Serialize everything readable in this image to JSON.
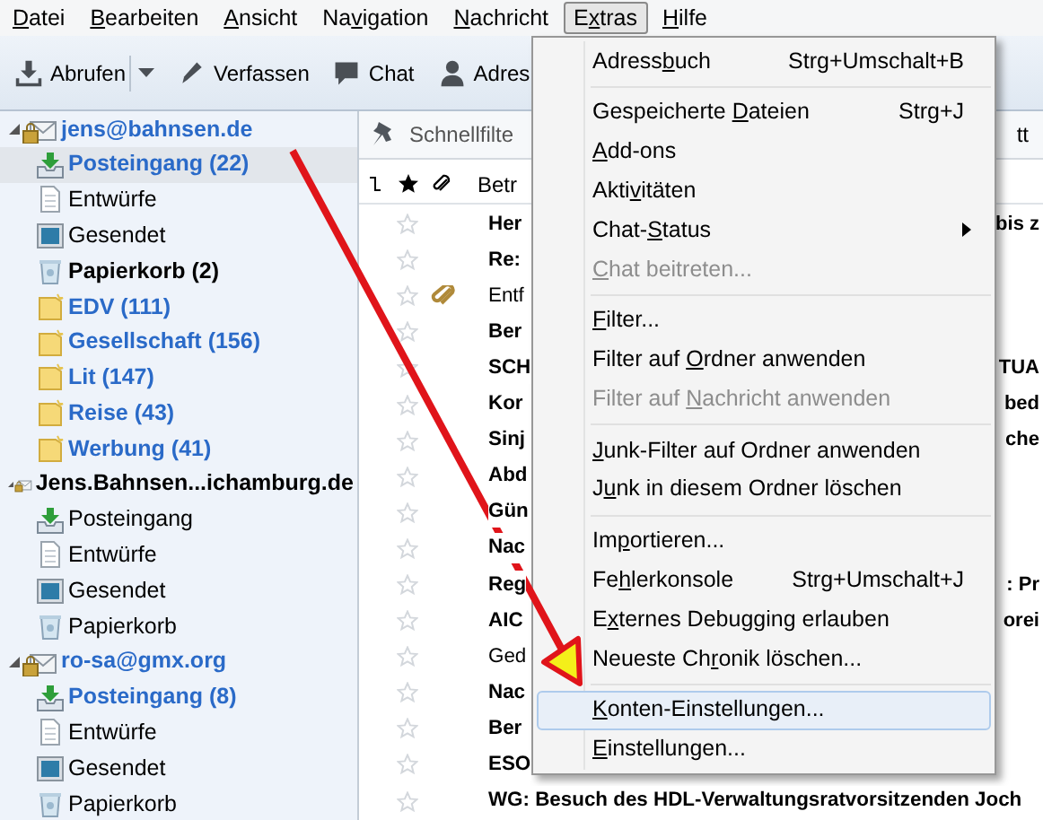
{
  "menubar": [
    {
      "key": "D",
      "after": "atei",
      "selected": false
    },
    {
      "key": "B",
      "after": "earbeiten",
      "selected": false
    },
    {
      "key": "A",
      "after": "nsicht",
      "selected": false
    },
    {
      "before": "Na",
      "key": "v",
      "after": "igation",
      "selected": false
    },
    {
      "key": "N",
      "after": "achricht",
      "selected": false
    },
    {
      "before": "E",
      "key": "x",
      "after": "tras",
      "selected": true
    },
    {
      "key": "H",
      "after": "ilfe",
      "selected": false
    }
  ],
  "toolbar": [
    {
      "kind": "get",
      "label": "Abrufen",
      "dropdown": true
    },
    {
      "kind": "compose",
      "label": "Verfassen",
      "dropdown": false
    },
    {
      "kind": "chat",
      "label": "Chat",
      "dropdown": false
    },
    {
      "kind": "contacts",
      "label": "Adres",
      "dropdown": false
    }
  ],
  "folders": [
    {
      "kind": "account",
      "label": "jens@bahnsen.de",
      "new": true,
      "unread": true,
      "expanded": true,
      "selected": false,
      "children": [
        {
          "kind": "inbox",
          "label": "Posteingang (22)",
          "new": true,
          "unread": true,
          "selected": true
        },
        {
          "kind": "drafts",
          "label": "Entwürfe",
          "new": false,
          "unread": false,
          "selected": false
        },
        {
          "kind": "sent",
          "label": "Gesendet",
          "new": false,
          "unread": false,
          "selected": false
        },
        {
          "kind": "trash",
          "label": "Papierkorb (2)",
          "new": false,
          "unread": true,
          "selected": false
        },
        {
          "kind": "folder",
          "label": "EDV (111)",
          "new": true,
          "unread": true,
          "selected": false
        },
        {
          "kind": "folder",
          "label": "Gesellschaft (156)",
          "new": true,
          "unread": true,
          "selected": false
        },
        {
          "kind": "folder",
          "label": "Lit (147)",
          "new": true,
          "unread": true,
          "selected": false
        },
        {
          "kind": "folder",
          "label": "Reise (43)",
          "new": true,
          "unread": true,
          "selected": false
        },
        {
          "kind": "folder",
          "label": "Werbung (41)",
          "new": true,
          "unread": true,
          "selected": false
        }
      ]
    },
    {
      "kind": "account",
      "label": "Jens.Bahnsen...ichamburg.de",
      "new": false,
      "unread": true,
      "expanded": true,
      "selected": false,
      "children": [
        {
          "kind": "inbox",
          "label": "Posteingang",
          "new": false,
          "unread": false,
          "selected": false
        },
        {
          "kind": "drafts",
          "label": "Entwürfe",
          "new": false,
          "unread": false,
          "selected": false
        },
        {
          "kind": "sent",
          "label": "Gesendet",
          "new": false,
          "unread": false,
          "selected": false
        },
        {
          "kind": "trash",
          "label": "Papierkorb",
          "new": false,
          "unread": false,
          "selected": false
        }
      ]
    },
    {
      "kind": "account",
      "label": "ro-sa@gmx.org",
      "new": true,
      "unread": true,
      "expanded": true,
      "selected": false,
      "children": [
        {
          "kind": "inbox",
          "label": "Posteingang (8)",
          "new": true,
          "unread": true,
          "selected": false
        },
        {
          "kind": "drafts",
          "label": "Entwürfe",
          "new": false,
          "unread": false,
          "selected": false
        },
        {
          "kind": "sent",
          "label": "Gesendet",
          "new": false,
          "unread": false,
          "selected": false
        },
        {
          "kind": "trash",
          "label": "Papierkorb",
          "new": false,
          "unread": false,
          "selected": false
        }
      ]
    }
  ],
  "quick_filter": {
    "label": "Schnellfilte",
    "tail": "tt"
  },
  "columns": {
    "subject": "Betr"
  },
  "messages": [
    {
      "subject": "Her",
      "tail": "bis z",
      "unread": true,
      "attachment": false
    },
    {
      "subject": "Re:",
      "unread": true,
      "attachment": false
    },
    {
      "subject": "Entf",
      "unread": false,
      "attachment": true
    },
    {
      "subject": "Ber",
      "unread": true,
      "attachment": false
    },
    {
      "subject": "SCH",
      "tail": "TUA",
      "unread": true,
      "attachment": false
    },
    {
      "subject": "Kor",
      "tail": "bed",
      "unread": true,
      "attachment": false
    },
    {
      "subject": "Sinj",
      "tail": "che",
      "unread": true,
      "attachment": false
    },
    {
      "subject": "Abd",
      "unread": true,
      "attachment": false
    },
    {
      "subject": "Gün",
      "unread": true,
      "attachment": false
    },
    {
      "subject": "Nac",
      "unread": true,
      "attachment": false
    },
    {
      "subject": "Reg",
      "tail": ": Pr",
      "unread": true,
      "attachment": false
    },
    {
      "subject": "AIC",
      "tail": "orei",
      "unread": true,
      "attachment": false
    },
    {
      "subject": "Ged",
      "unread": false,
      "attachment": false
    },
    {
      "subject": "Nac",
      "unread": true,
      "attachment": false
    },
    {
      "subject": "Ber",
      "unread": true,
      "attachment": false
    },
    {
      "subject": "ESO",
      "unread": true,
      "attachment": false
    },
    {
      "subject": "WG: Besuch des HDL-Verwaltungsratvorsitzenden Joch",
      "unread": true,
      "attachment": false
    }
  ],
  "extras_menu": [
    {
      "kind": "item",
      "before": "Adress",
      "key": "b",
      "after": "uch",
      "shortcut": "Strg+Umschalt+B",
      "disabled": false,
      "submenu": false,
      "selected": false
    },
    {
      "kind": "separator"
    },
    {
      "kind": "item",
      "before": "Gespeicherte ",
      "key": "D",
      "after": "ateien",
      "shortcut": "Strg+J",
      "disabled": false,
      "submenu": false,
      "selected": false
    },
    {
      "kind": "item",
      "key": "A",
      "after": "dd-ons",
      "disabled": false,
      "submenu": false,
      "selected": false
    },
    {
      "kind": "item",
      "before": "Akti",
      "key": "v",
      "after": "itäten",
      "disabled": false,
      "submenu": false,
      "selected": false
    },
    {
      "kind": "item",
      "before": "Chat-",
      "key": "S",
      "after": "tatus",
      "disabled": false,
      "submenu": true,
      "selected": false
    },
    {
      "kind": "item",
      "key": "C",
      "after": "hat beitreten...",
      "disabled": true,
      "submenu": false,
      "selected": false
    },
    {
      "kind": "separator"
    },
    {
      "kind": "item",
      "key": "F",
      "after": "ilter...",
      "disabled": false,
      "submenu": false,
      "selected": false
    },
    {
      "kind": "item",
      "before": "Filter auf ",
      "key": "O",
      "after": "rdner anwenden",
      "disabled": false,
      "submenu": false,
      "selected": false
    },
    {
      "kind": "item",
      "before": "Filter auf ",
      "key": "N",
      "after": "achricht anwenden",
      "disabled": true,
      "submenu": false,
      "selected": false
    },
    {
      "kind": "separator"
    },
    {
      "kind": "item",
      "key": "J",
      "after": "unk-Filter auf Ordner anwenden",
      "disabled": false,
      "submenu": false,
      "selected": false
    },
    {
      "kind": "item",
      "before": "J",
      "key": "u",
      "after": "nk in diesem Ordner löschen",
      "disabled": false,
      "submenu": false,
      "selected": false
    },
    {
      "kind": "separator"
    },
    {
      "kind": "item",
      "before": "Im",
      "key": "p",
      "after": "ortieren...",
      "disabled": false,
      "submenu": false,
      "selected": false
    },
    {
      "kind": "item",
      "before": "Fe",
      "key": "h",
      "after": "lerkonsole",
      "shortcut": "Strg+Umschalt+J",
      "disabled": false,
      "submenu": false,
      "selected": false
    },
    {
      "kind": "item",
      "before": "E",
      "key": "x",
      "after": "ternes Debugging erlauben",
      "disabled": false,
      "submenu": false,
      "selected": false
    },
    {
      "kind": "item",
      "before": "Neueste Ch",
      "key": "r",
      "after": "onik löschen...",
      "disabled": false,
      "submenu": false,
      "selected": false
    },
    {
      "kind": "separator"
    },
    {
      "kind": "item",
      "key": "K",
      "after": "onten-Einstellungen...",
      "disabled": false,
      "submenu": false,
      "selected": true
    },
    {
      "kind": "item",
      "key": "E",
      "after": "instellungen...",
      "disabled": false,
      "submenu": false,
      "selected": false
    }
  ]
}
